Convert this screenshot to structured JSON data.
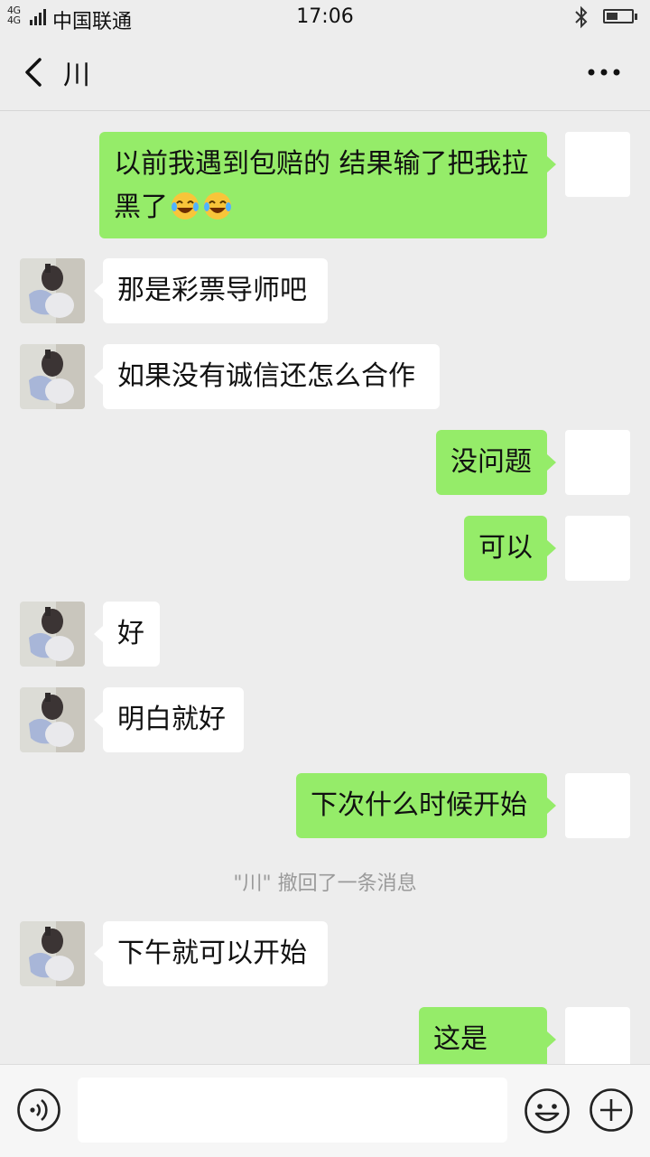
{
  "status_bar": {
    "network": "4G 4G",
    "carrier": "中国联通",
    "time": "17:06",
    "battery_level": 0.45
  },
  "header": {
    "back_icon": "chevron-left-icon",
    "title": "川",
    "more_icon": "more-dots-icon"
  },
  "colors": {
    "sent_bubble": "#95ec69",
    "received_bubble": "#ffffff",
    "background": "#ededed"
  },
  "messages": [
    {
      "side": "right",
      "text": "以前我遇到包赔的 结果输了把我拉黑了",
      "emoji": "tears-of-joy x2"
    },
    {
      "side": "left",
      "text": "那是彩票导师吧"
    },
    {
      "side": "left",
      "text": "如果没有诚信还怎么合作"
    },
    {
      "side": "right",
      "text": "没问题"
    },
    {
      "side": "right",
      "text": "可以"
    },
    {
      "side": "left",
      "text": "好"
    },
    {
      "side": "left",
      "text": "明白就好"
    },
    {
      "side": "right",
      "text": "下次什么时候开始"
    },
    {
      "side": "system",
      "text": "\"川\" 撤回了一条消息"
    },
    {
      "side": "left",
      "text": "下午就可以开始"
    },
    {
      "side": "right",
      "text": "这是谁？"
    }
  ],
  "input_bar": {
    "voice_icon": "voice-icon",
    "text_value": "",
    "emoji_icon": "emoji-icon",
    "plus_icon": "plus-icon"
  }
}
